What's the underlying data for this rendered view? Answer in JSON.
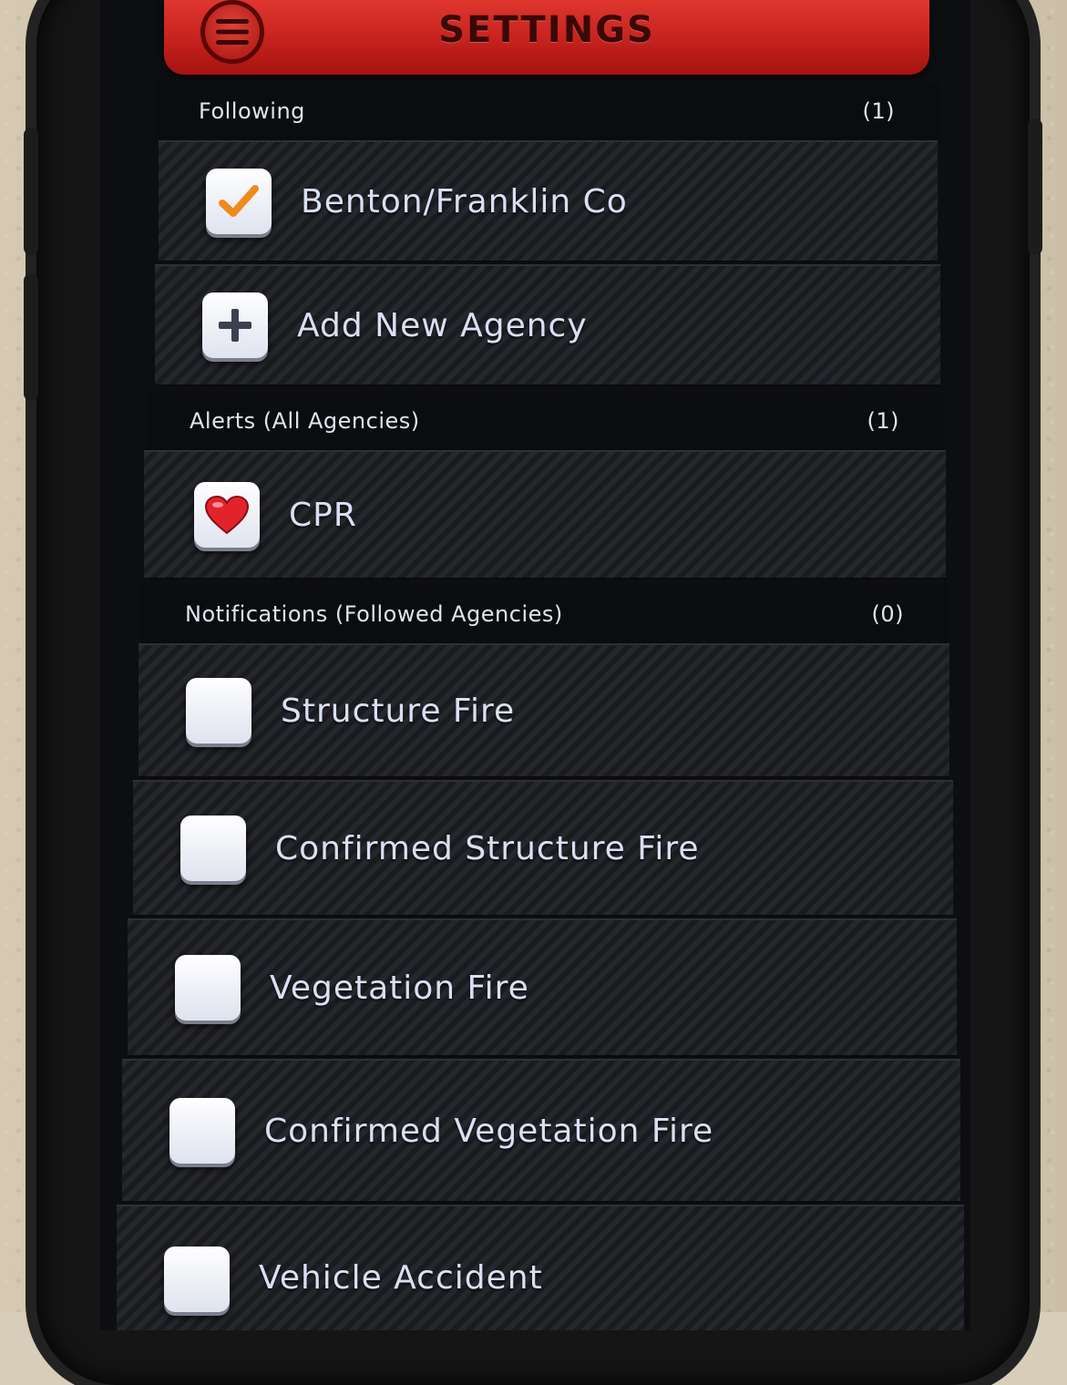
{
  "header": {
    "title": "SETTINGS"
  },
  "following": {
    "label": "Following",
    "count": "(1)",
    "items": [
      {
        "label": "Benton/Franklin Co"
      },
      {
        "label": "Add New Agency"
      }
    ]
  },
  "alerts": {
    "label": "Alerts (All Agencies)",
    "count": "(1)",
    "items": [
      {
        "label": "CPR"
      }
    ]
  },
  "notifications": {
    "label": "Notifications (Followed Agencies)",
    "count": "(0)",
    "items": [
      {
        "label": "Structure Fire"
      },
      {
        "label": "Confirmed Structure Fire"
      },
      {
        "label": "Vegetation Fire"
      },
      {
        "label": "Confirmed Vegetation Fire"
      },
      {
        "label": "Vehicle Accident"
      }
    ]
  },
  "colors": {
    "header_red": "#c8241f",
    "check_orange": "#f08a1c",
    "heart_red": "#e2232b"
  }
}
